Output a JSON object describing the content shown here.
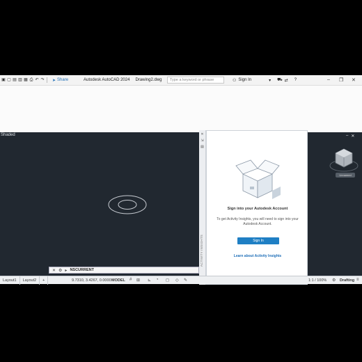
{
  "titlebar": {
    "share_label": "Share",
    "app_title": "Autodesk AutoCAD 2024",
    "doc_title": "Drawing2.dwg",
    "search_placeholder": "Type a keyword or phrase",
    "signin_label": "Sign In"
  },
  "viewport": {
    "label": "Shaded",
    "viewcube_badge": "Unnamed"
  },
  "panel": {
    "title": "Sign into your Autodesk Account",
    "description": "To get Activity Insights, you will need to sign into your Autodesk Account.",
    "signin_button": "Sign In",
    "learn_link": "Learn about Activity Insights",
    "strip_label": "ACTIVITY INSIGHTS"
  },
  "commandline": {
    "text": "NSCURRENT"
  },
  "statusbar": {
    "tabs": [
      "Layout1",
      "Layout2"
    ],
    "coordinates": "9.7310, 3.4267, 0.0000",
    "model_label": "MODEL",
    "zoom": "1:1 / 100%",
    "workspace": "Drafting"
  },
  "colors": {
    "canvas_bg": "#212830",
    "accent": "#1f7fc4"
  }
}
